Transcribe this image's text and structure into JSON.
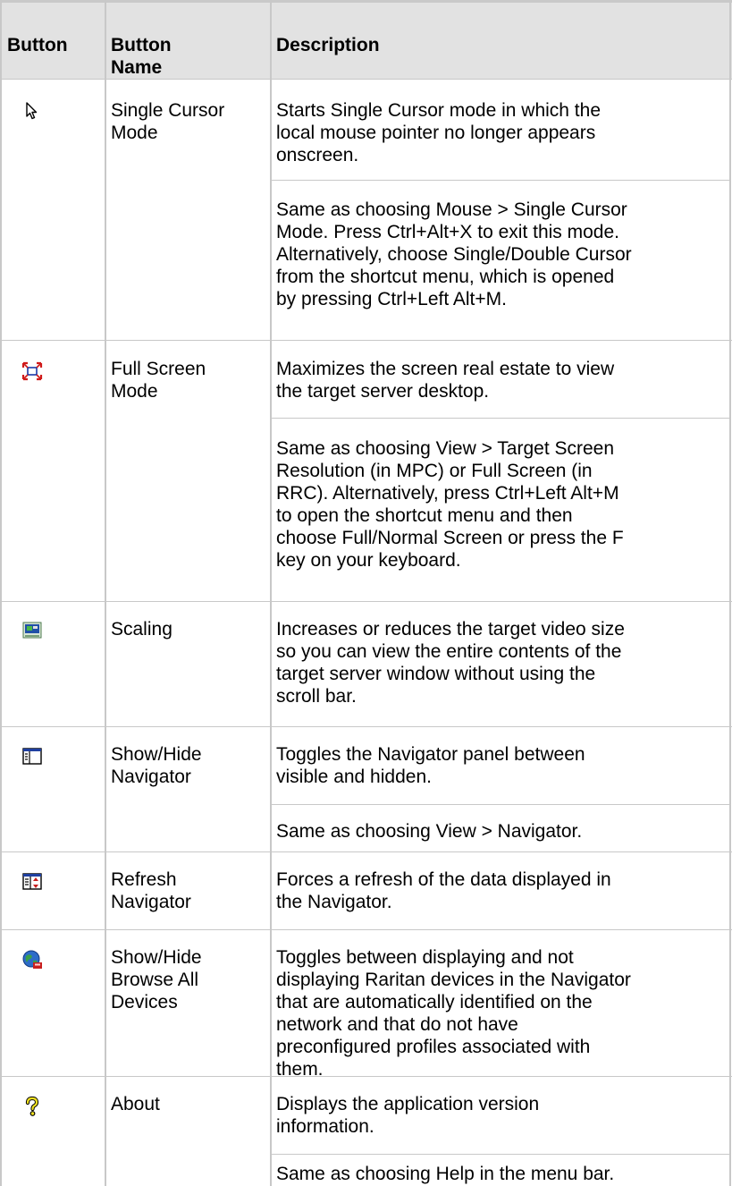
{
  "header": {
    "button": "Button",
    "button_name_1": "Button",
    "button_name_2": "Name",
    "description": "Description"
  },
  "rows": [
    {
      "icon": "single-cursor-icon",
      "name": [
        "Single Cursor",
        "Mode"
      ],
      "desc1": [
        "Starts Single Cursor mode in which the",
        "local mouse pointer no longer appears",
        "onscreen."
      ],
      "desc2": [
        "Same as choosing Mouse > Single Cursor",
        "Mode. Press Ctrl+Alt+X to exit this mode.",
        "Alternatively, choose Single/Double Cursor",
        "from the shortcut menu, which is opened",
        "by pressing Ctrl+Left Alt+M."
      ]
    },
    {
      "icon": "full-screen-icon",
      "name": [
        "Full Screen",
        "Mode"
      ],
      "desc1": [
        "Maximizes the screen real estate to view",
        "the target server desktop."
      ],
      "desc2": [
        "Same as choosing View > Target Screen",
        "Resolution (in MPC) or Full Screen (in",
        "RRC). Alternatively, press Ctrl+Left Alt+M",
        "to open the shortcut menu and then",
        "choose Full/Normal Screen or press the F",
        "key on your keyboard."
      ]
    },
    {
      "icon": "scaling-icon",
      "name": [
        "Scaling"
      ],
      "desc1": [
        "Increases or reduces the target video size",
        "so you can view the entire contents of the",
        "target server window without using the",
        "scroll bar."
      ]
    },
    {
      "icon": "navigator-panel-icon",
      "name": [
        "Show/Hide",
        "Navigator"
      ],
      "desc1": [
        "Toggles the Navigator panel between",
        "visible and hidden."
      ],
      "desc2": [
        "Same as choosing View > Navigator."
      ]
    },
    {
      "icon": "refresh-navigator-icon",
      "name": [
        "Refresh",
        "Navigator"
      ],
      "desc1": [
        "Forces a refresh of the data displayed in",
        "the Navigator."
      ]
    },
    {
      "icon": "browse-devices-globe-icon",
      "name": [
        "Show/Hide",
        "Browse All",
        "Devices"
      ],
      "desc1": [
        "Toggles between displaying and not",
        "displaying Raritan devices in the Navigator",
        "that are automatically identified on the",
        "network and that do not have",
        "preconfigured profiles associated with",
        "them."
      ]
    },
    {
      "icon": "about-question-icon",
      "name": [
        "About"
      ],
      "desc1": [
        "Displays the application version",
        "information."
      ],
      "desc2": [
        "Same as choosing Help in the menu bar."
      ]
    }
  ]
}
